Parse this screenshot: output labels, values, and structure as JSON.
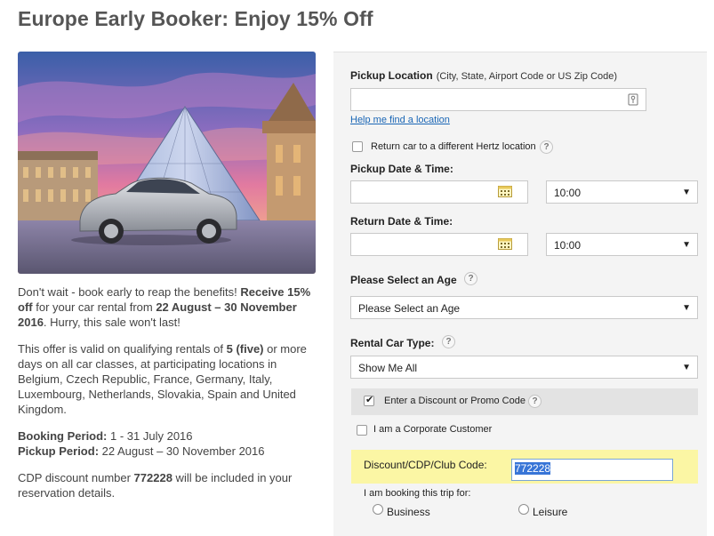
{
  "page": {
    "title": "Europe Early Booker: Enjoy 15% Off"
  },
  "promo": {
    "p1_prefix": "Don't wait - book early to reap the benefits! ",
    "p1_bold": "Receive 15% off",
    "p1_mid": " for your car rental from ",
    "p1_dates": "22 August – 30 November 2016",
    "p1_suffix": ". Hurry, this sale won't last!",
    "p2_prefix": "This offer is valid on qualifying rentals of ",
    "p2_bold": "5 (five)",
    "p2_suffix": " or more days on all car classes, at participating locations in Belgium, Czech Republic, France, Germany, Italy, Luxembourg, Netherlands, Slovakia, Spain and United Kingdom.",
    "booking_label": "Booking Period:",
    "booking_value": " 1 - 31 July 2016",
    "pickup_label": "Pickup Period:",
    "pickup_value": " 22 August – 30 November 2016",
    "cdp_prefix": "CDP discount number ",
    "cdp_number": "772228",
    "cdp_suffix": " will be included in your reservation details."
  },
  "form": {
    "pickup_location_label": "Pickup Location",
    "pickup_location_hint": "(City, State, Airport Code or US Zip Code)",
    "pickup_location_value": "",
    "help_link": "Help me find a location",
    "return_different_label": "Return car to a different Hertz location",
    "pickup_datetime_label": "Pickup Date & Time:",
    "pickup_date_value": "",
    "pickup_time_value": "10:00",
    "return_datetime_label": "Return Date & Time:",
    "return_date_value": "",
    "return_time_value": "10:00",
    "age_label": "Please Select an Age",
    "age_value": "Please Select an Age",
    "car_type_label": "Rental Car Type:",
    "car_type_value": "Show Me All",
    "promo_code_label": "Enter a Discount or Promo Code",
    "promo_code_checked": true,
    "corporate_label": "I am a Corporate Customer",
    "discount_label": "Discount/CDP/Club Code:",
    "discount_value": "772228",
    "trip_for_label": "I am booking this trip for:",
    "trip_business": "Business",
    "trip_leisure": "Leisure",
    "help_glyph": "?"
  },
  "colors": {
    "link": "#1a66b5",
    "highlight": "#fbf6a4",
    "selection": "#3875d7"
  }
}
